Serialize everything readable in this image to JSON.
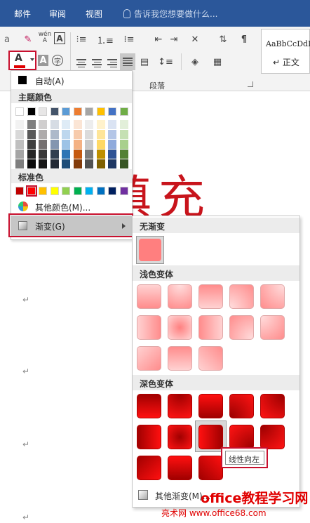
{
  "ribbon_tabs": {
    "mail": "邮件",
    "review": "审阅",
    "view": "视图"
  },
  "tell_me": {
    "placeholder": "告诉我您想要做什么..."
  },
  "ribbon": {
    "group_paragraph": "段落",
    "style_preview_text": "AaBbCcDdI",
    "style_name": "↵ 正文",
    "font_color_glyph": "A",
    "pinyin_label": "wén",
    "pinyin_char": "A",
    "font_color_bar": "#e00000"
  },
  "document": {
    "big_text": "填充",
    "left_frag": "'"
  },
  "color_menu": {
    "auto_label": "自动(A)",
    "theme_colors_title": "主题颜色",
    "standard_colors_title": "标准色",
    "more_colors_label": "其他颜色(M)...",
    "gradient_label": "渐变(G)",
    "theme_top_row": [
      "#ffffff",
      "#000000",
      "#e7e6e6",
      "#44546a",
      "#5b9bd5",
      "#ed7d31",
      "#a5a5a5",
      "#ffc000",
      "#4472c4",
      "#70ad47"
    ],
    "theme_shades": [
      [
        "#f2f2f2",
        "#7f7f7f",
        "#d0cece",
        "#d6dce4",
        "#deebf6",
        "#fbe5d5",
        "#ededed",
        "#fff2cc",
        "#dae3f3",
        "#e2efd9"
      ],
      [
        "#d8d8d8",
        "#595959",
        "#aeabab",
        "#adb9ca",
        "#bdd7ee",
        "#f7cbac",
        "#dbdbdb",
        "#fee599",
        "#b4c6e7",
        "#c5e0b3"
      ],
      [
        "#bfbfbf",
        "#3f3f3f",
        "#757070",
        "#8496b0",
        "#9dc3e6",
        "#f4b183",
        "#c9c9c9",
        "#ffd965",
        "#8faadc",
        "#a8d08d"
      ],
      [
        "#a5a5a5",
        "#262626",
        "#3a3838",
        "#323f4f",
        "#2e75b5",
        "#c55a11",
        "#7b7b7b",
        "#bf9000",
        "#2f5496",
        "#538135"
      ],
      [
        "#7f7f7f",
        "#0c0c0c",
        "#171616",
        "#222a35",
        "#1e4e79",
        "#833c0b",
        "#525252",
        "#7f6000",
        "#1f3864",
        "#375623"
      ]
    ],
    "standard_colors": [
      "#c00000",
      "#ff0000",
      "#ffc000",
      "#ffff00",
      "#92d050",
      "#00b050",
      "#00b0f0",
      "#0070c0",
      "#002060",
      "#7030a0"
    ]
  },
  "gradient_menu": {
    "no_gradient_title": "无渐变",
    "light_variations_title": "浅色变体",
    "dark_variations_title": "深色变体",
    "tooltip": "线性向左",
    "other_gradients_label": "其他渐变(M)..."
  },
  "watermark": {
    "line1": "office教程学习网",
    "line2": "亮术网 www.office68.com"
  }
}
